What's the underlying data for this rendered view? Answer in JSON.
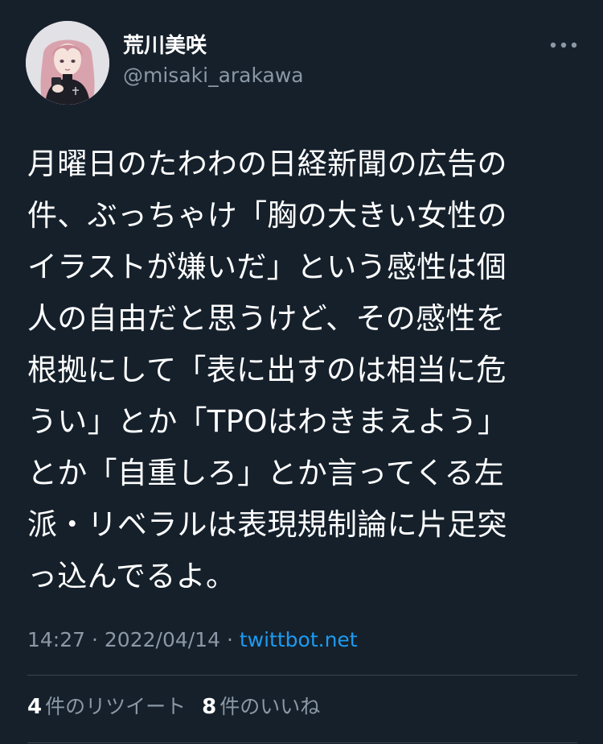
{
  "author": {
    "display_name": "荒川美咲",
    "handle": "@misaki_arakawa",
    "avatar_icon": "avatar-illustration"
  },
  "menu": {
    "icon": "more-horizontal-icon"
  },
  "tweet": {
    "text": "月曜日のたわわの日経新聞の広告の\n件、ぶっちゃけ「胸の大きい女性の\nイラストが嫌いだ」という感性は個\n人の自由だと思うけど、その感性を\n根拠にして「表に出すのは相当に危\nうい」とか「TPOはわきまえよう」\nとか「自重しろ」とか言ってくる左\n派・リベラルは表現規制論に片足突\nっ込んでるよ。",
    "time": "14:27",
    "date": "2022/04/14",
    "separator": "·",
    "source": "twittbot.net"
  },
  "stats": {
    "retweets_count": "4",
    "retweets_label": "件のリツイート",
    "likes_count": "8",
    "likes_label": "件のいいね"
  },
  "colors": {
    "background": "#15202b",
    "primary_text": "#ffffff",
    "secondary_text": "#8b98a5",
    "link": "#1d9bf0",
    "divider": "#38444d"
  }
}
